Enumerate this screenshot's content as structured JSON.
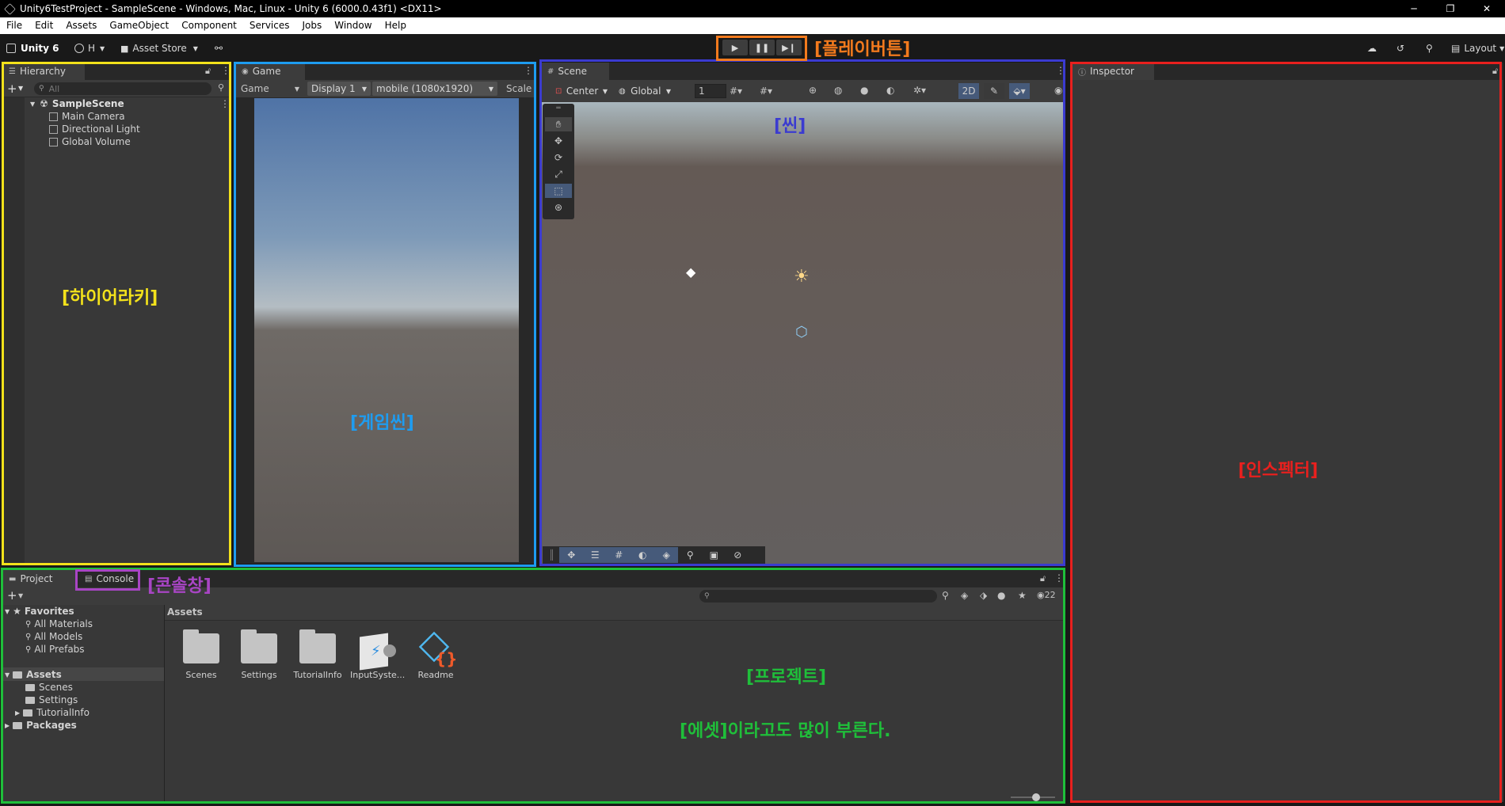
{
  "window": {
    "title": "Unity6TestProject - SampleScene - Windows, Mac, Linux - Unity 6 (6000.0.43f1) <DX11>",
    "minimize": "─",
    "restore": "❐",
    "close": "✕"
  },
  "menu": [
    "File",
    "Edit",
    "Assets",
    "GameObject",
    "Component",
    "Services",
    "Jobs",
    "Window",
    "Help"
  ],
  "toolbar": {
    "logo_label": "Unity 6",
    "account_label": "H",
    "asset_store_label": "Asset Store",
    "layout_label": "Layout"
  },
  "hierarchy": {
    "tab_label": "Hierarchy",
    "search_placeholder": "All",
    "scene_name": "SampleScene",
    "items": [
      "Main Camera",
      "Directional Light",
      "Global Volume"
    ]
  },
  "game": {
    "tab_label": "Game",
    "mode_label": "Game",
    "display_label": "Display 1",
    "resolution_label": "mobile (1080x1920)",
    "scale_label": "Scale"
  },
  "scene": {
    "tab_label": "Scene",
    "pivot_label": "Center",
    "space_label": "Global",
    "grid_value": "1",
    "mode_2d_label": "2D"
  },
  "inspector": {
    "tab_label": "Inspector"
  },
  "project": {
    "tab_project": "Project",
    "tab_console": "Console",
    "favorites_label": "Favorites",
    "favorites": [
      "All Materials",
      "All Models",
      "All Prefabs"
    ],
    "assets_label": "Assets",
    "asset_folders": [
      "Scenes",
      "Settings",
      "TutorialInfo"
    ],
    "packages_label": "Packages",
    "breadcrumb": "Assets",
    "hidden_count": "22",
    "assets": [
      "Scenes",
      "Settings",
      "TutorialInfo",
      "InputSyste...",
      "Readme"
    ]
  },
  "annotations": {
    "playbutton": "[플레이버튼]",
    "hierarchy": "[하이어라키]",
    "game_scene": "[게임씬]",
    "scene": "[씬]",
    "inspector": "[인스펙터]",
    "console": "[콘솔창]",
    "project": "[프로젝트]",
    "assets_note": "[에셋]이라고도 많이 부른다."
  },
  "colors": {
    "hierarchy_outline": "#f3e21b",
    "game_outline": "#1e9cf0",
    "scene_outline": "#3b3bd0",
    "inspector_outline": "#e8201e",
    "project_outline": "#1fbf3a",
    "console_outline": "#a845c4",
    "play_outline": "#f37a1d"
  }
}
